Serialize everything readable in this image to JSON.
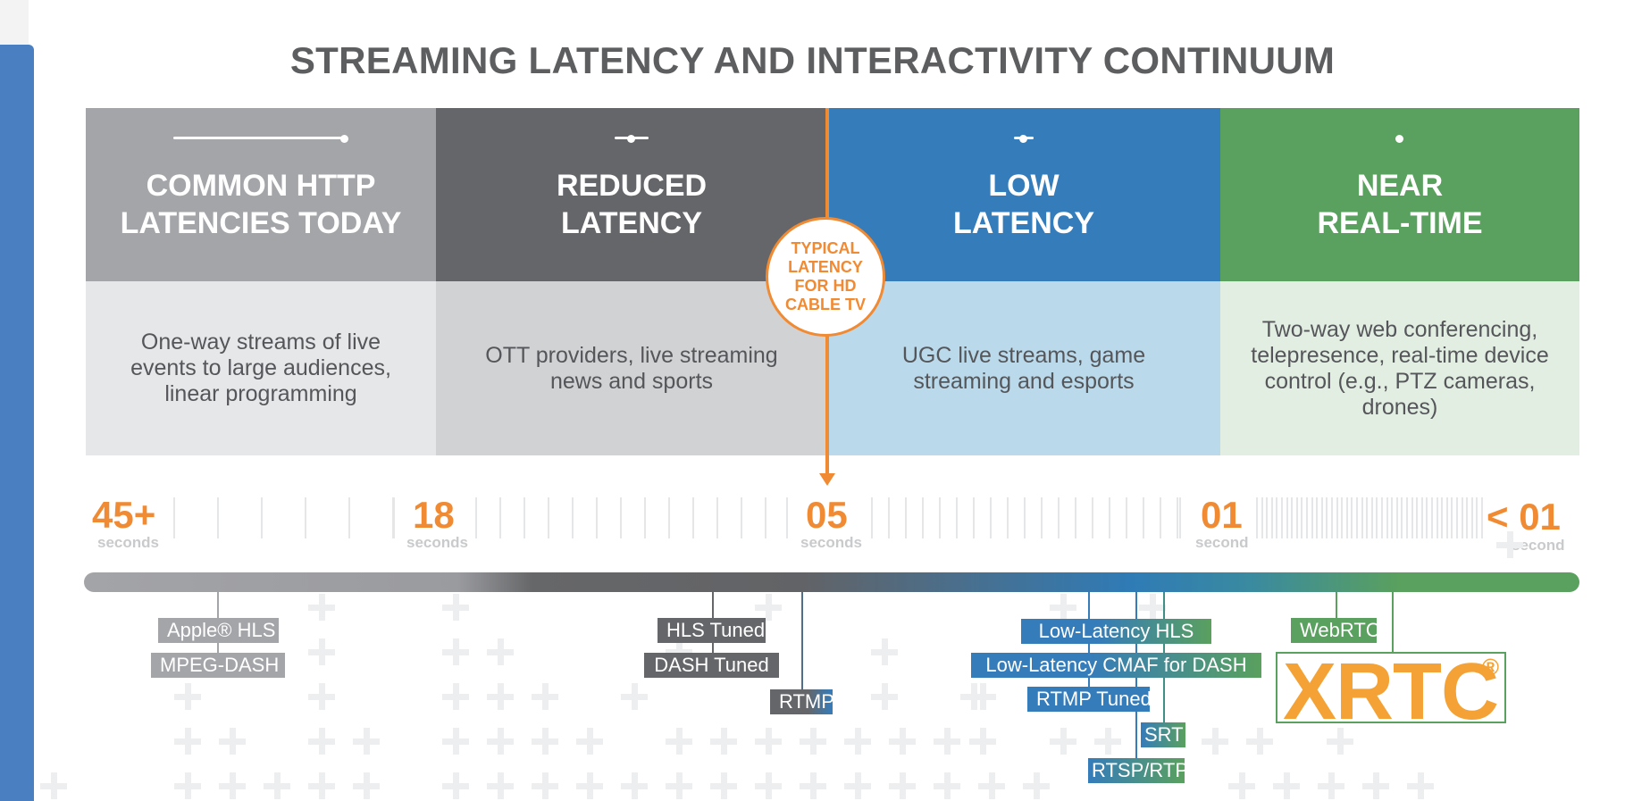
{
  "title": "STREAMING LATENCY AND INTERACTIVITY CONTINUUM",
  "colors": {
    "common": "#a4a5a9",
    "common_desc": "#e6e7e9",
    "reduced": "#656669",
    "reduced_desc": "#d1d2d4",
    "low": "#357cbb",
    "low_desc": "#bad9ea",
    "near": "#5aa05e",
    "near_desc": "#e3eee3",
    "accent_orange": "#f08a33",
    "xrtc_orange": "#f4a235"
  },
  "columns": [
    {
      "id": "common",
      "title_line1": "COMMON HTTP",
      "title_line2": "LATENCIES TODAY",
      "description": "One-way streams of live events to large audiences, linear programming"
    },
    {
      "id": "reduced",
      "title_line1": "REDUCED",
      "title_line2": "LATENCY",
      "description": "OTT providers, live streaming news and sports"
    },
    {
      "id": "low",
      "title_line1": "LOW",
      "title_line2": "LATENCY",
      "description": "UGC live streams, game streaming and esports"
    },
    {
      "id": "near",
      "title_line1": "NEAR",
      "title_line2": "REAL-TIME",
      "description": "Two-way web conferencing, telepresence, real-time device control (e.g., PTZ cameras, drones)"
    }
  ],
  "callout": {
    "text": "TYPICAL LATENCY FOR HD CABLE TV"
  },
  "scale": [
    {
      "value": "45+",
      "unit": "seconds"
    },
    {
      "value": "18",
      "unit": "seconds"
    },
    {
      "value": "05",
      "unit": "seconds"
    },
    {
      "value": "01",
      "unit": "second"
    },
    {
      "value": "< 01",
      "unit": "second"
    }
  ],
  "protocols": [
    {
      "label": "Apple® HLS",
      "group": "common"
    },
    {
      "label": "MPEG-DASH",
      "group": "common"
    },
    {
      "label": "HLS Tuned",
      "group": "reduced"
    },
    {
      "label": "DASH Tuned",
      "group": "reduced"
    },
    {
      "label": "RTMP",
      "group": "reduced-low"
    },
    {
      "label": "Low-Latency HLS",
      "group": "low"
    },
    {
      "label": "Low-Latency CMAF for DASH",
      "group": "low"
    },
    {
      "label": "RTMP Tuned",
      "group": "low"
    },
    {
      "label": "SRT",
      "group": "low-near"
    },
    {
      "label": "RTSP/RTP",
      "group": "low-near"
    },
    {
      "label": "WebRTC",
      "group": "near"
    }
  ],
  "xrtc": {
    "label": "XRTC",
    "mark": "®"
  }
}
